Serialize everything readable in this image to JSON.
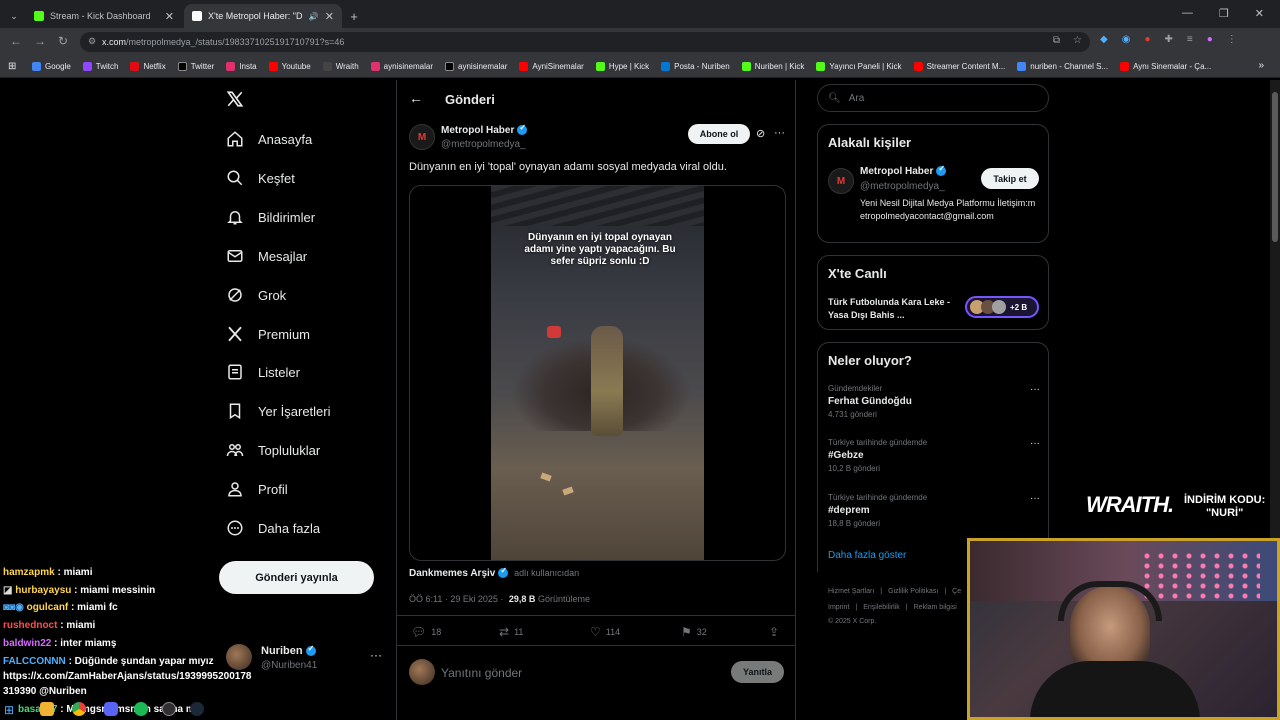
{
  "browser": {
    "tabs": [
      {
        "title": "Stream - Kick Dashboard",
        "color": "#53fc18"
      },
      {
        "title": "X'te Metropol Haber: \"Düny",
        "color": "#ffffff"
      }
    ],
    "url_host": "x.com",
    "url_path": "/metropolmedya_/status/1983371025191710791?s=46",
    "bookmarks": [
      {
        "label": "Google",
        "color": "#4285f4"
      },
      {
        "label": "Twitch",
        "color": "#9146ff"
      },
      {
        "label": "Netflix",
        "color": "#e50914"
      },
      {
        "label": "Twitter",
        "color": "#000000"
      },
      {
        "label": "Insta",
        "color": "#e1306c"
      },
      {
        "label": "Youtube",
        "color": "#ff0000"
      },
      {
        "label": "Wraith",
        "color": "#444444"
      },
      {
        "label": "aynisinemalar",
        "color": "#e1306c"
      },
      {
        "label": "aynisinemalar",
        "color": "#000000"
      },
      {
        "label": "AyniSinemalar",
        "color": "#ff0000"
      },
      {
        "label": "Hype | Kick",
        "color": "#53fc18"
      },
      {
        "label": "Posta - Nuriben",
        "color": "#0078d4"
      },
      {
        "label": "Nuriben | Kick",
        "color": "#53fc18"
      },
      {
        "label": "Yayıncı Paneli | Kick",
        "color": "#53fc18"
      },
      {
        "label": "Streamer Content M...",
        "color": "#ff0000"
      },
      {
        "label": "nuriben - Channel S...",
        "color": "#4285f4"
      },
      {
        "label": "Aynı Sinemalar - Ça...",
        "color": "#ff0000"
      }
    ]
  },
  "nav": {
    "items": [
      "Anasayfa",
      "Keşfet",
      "Bildirimler",
      "Mesajlar",
      "Grok",
      "Premium",
      "Listeler",
      "Yer İşaretleri",
      "Topluluklar",
      "Profil",
      "Daha fazla"
    ],
    "post_button": "Gönderi yayınla",
    "account_name": "Nuriben",
    "account_handle": "@Nuriben41"
  },
  "post": {
    "header": "Gönderi",
    "author": "Metropol Haber",
    "handle": "@metropolmedya_",
    "subscribe": "Abone ol",
    "text": "Dünyanın en iyi 'topal' oynayan adamı sosyal medyada viral oldu.",
    "video_caption": "Dünyanın en iyi topal oynayan adamı yine yaptı yapacağını. Bu sefer süpriz sonlu :D",
    "source_name": "Dankmemes Arşiv",
    "source_suffix": "adlı kullanıcıdan",
    "time": "ÖÖ 6:11 · 29 Eki 2025 ·",
    "views": "29,8 B",
    "views_label": "Görüntüleme",
    "stats": {
      "replies": "18",
      "reposts": "11",
      "likes": "114",
      "bookmarks": "32"
    },
    "reply_placeholder": "Yanıtını gönder",
    "reply_button": "Yanıtla"
  },
  "sidebar": {
    "search_placeholder": "Ara",
    "related_title": "Alakalı kişiler",
    "related_name": "Metropol Haber",
    "related_handle": "@metropolmedya_",
    "follow": "Takip et",
    "bio": "Yeni Nesil Dijital Medya Platformu İletişim:metropolmedyacontact@gmail.com",
    "live_title": "X'te Canlı",
    "live_text": "Türk Futbolunda Kara Leke - Yasa Dışı Bahis ...",
    "live_count": "+2 B",
    "trends_title": "Neler oluyor?",
    "trends": [
      {
        "context": "Gündemdekiler",
        "name": "Ferhat Gündoğdu",
        "count": "4.731 gönderi"
      },
      {
        "context": "Türkiye tarihinde gündemde",
        "name": "#Gebze",
        "count": "10,2 B gönderi"
      },
      {
        "context": "Türkiye tarihinde gündemde",
        "name": "#deprem",
        "count": "18,8 B gönderi"
      }
    ],
    "show_more": "Daha fazla göster",
    "footer1": [
      "Hizmet Şartları",
      "Gizlilik Politikası",
      "Çe"
    ],
    "footer2": [
      "Imprint",
      "Erişilebilirlik",
      "Reklam bilgisi"
    ],
    "copyright": "© 2025 X Corp."
  },
  "overlay": {
    "chat": [
      {
        "user": "hamzapmk",
        "msg": ": miami",
        "color": "#ffd54a"
      },
      {
        "user": "hurbayaysu",
        "msg": ": miami messinin",
        "color": "#ffd54a"
      },
      {
        "user": "ogulcanf",
        "msg": ": miami fc",
        "color": "#ffd54a"
      },
      {
        "user": "rushednoct",
        "msg": ": miami",
        "color": "#ff4d4d"
      },
      {
        "user": "baldwin22",
        "msg": ": inter miamş",
        "color": "#d66bff"
      },
      {
        "user": "FALCCONNN",
        "msg": ": Düğünde şundan yapar mıyız",
        "color": "#4fb0ff"
      },
      {
        "user": "",
        "msg": "https://x.com/ZamHaberAjans/status/1939995200178",
        "color": "#ffffff"
      },
      {
        "user": "",
        "msg": "319390 @Nuriben",
        "color": "#ffffff"
      },
      {
        "user": "basak_7",
        "msg": ": Mdmgsmsmsmsn sarma mıı",
        "color": "#4fd17a"
      }
    ],
    "wraith": "WRAITH.",
    "discount_line1": "İNDİRİM KODU:",
    "discount_line2": "\"NURİ\""
  }
}
